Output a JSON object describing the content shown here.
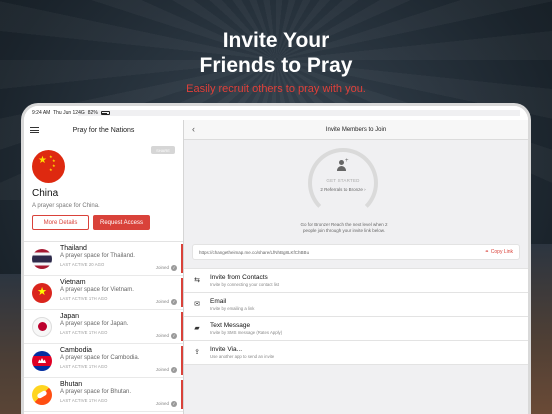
{
  "headline": {
    "title_line1": "Invite Your",
    "title_line2": "Friends to Pray",
    "subtitle": "Easily recruit others to pray with you."
  },
  "statusbar": {
    "time": "9:24 AM",
    "date": "Thu Jun 12",
    "signal": "4G",
    "battery": "82%"
  },
  "left_panel": {
    "title": "Pray for the Nations",
    "share_label": "SHARE",
    "selected_country": {
      "name": "China",
      "description": "A prayer space for China."
    },
    "more_details_label": "More Details",
    "request_access_label": "Request Access",
    "list": [
      {
        "name": "Thailand",
        "description": "A prayer space for Thailand.",
        "meta": "LAST ACTIVE 20 AGO",
        "status": "Joined",
        "flag": "thailand"
      },
      {
        "name": "Vietnam",
        "description": "A prayer space for Vietnam.",
        "meta": "LAST ACTIVE 17H AGO",
        "status": "Joined",
        "flag": "vietnam"
      },
      {
        "name": "Japan",
        "description": "A prayer space for Japan.",
        "meta": "LAST ACTIVE 17H AGO",
        "status": "Joined",
        "flag": "japan"
      },
      {
        "name": "Cambodia",
        "description": "A prayer space for Cambodia.",
        "meta": "LAST ACTIVE 17H AGO",
        "status": "Joined",
        "flag": "cambodia"
      },
      {
        "name": "Bhutan",
        "description": "A prayer space for Bhutan.",
        "meta": "LAST ACTIVE 17H AGO",
        "status": "Joined",
        "flag": "bhutan"
      }
    ]
  },
  "right_panel": {
    "title": "Invite Members to Join",
    "get_started": "GET STARTED",
    "referrals": "2 Referrals to Bronze",
    "goal_text_line1": "Go for Bronze! Reach the next level when 2",
    "goal_text_line2": "people join through your invite link below.",
    "invite_link": "https://changetheimap.me.co/share/LfNhBg8LKfChBBu",
    "copy_link_label": "Copy Link",
    "options": [
      {
        "title": "Invite from Contacts",
        "subtitle": "Invite by connecting your contact list",
        "icon": "arrows-icon"
      },
      {
        "title": "Email",
        "subtitle": "Invite by emailing a link",
        "icon": "mail-icon"
      },
      {
        "title": "Text Message",
        "subtitle": "Invite by SMS message (Rates Apply)",
        "icon": "chat-icon"
      },
      {
        "title": "Invite Via...",
        "subtitle": "Use another app to send an invite",
        "icon": "share-icon"
      }
    ]
  }
}
